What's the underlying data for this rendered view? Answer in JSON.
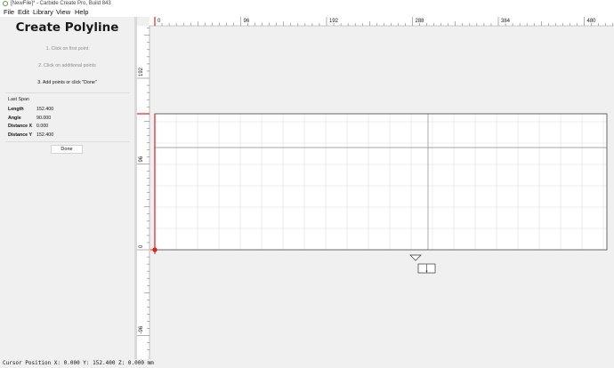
{
  "window": {
    "title": "[NewFile]* - Carbide Create Pro, Build 843"
  },
  "menu": {
    "items": [
      {
        "label": "File"
      },
      {
        "label": "Edit"
      },
      {
        "label": "Library"
      },
      {
        "label": "View"
      },
      {
        "label": "Help"
      }
    ]
  },
  "panel": {
    "title": "Create Polyline",
    "steps": [
      "1. Click on first point",
      "2. Click on additional points",
      "3. Add points or click \"Done\""
    ],
    "last_span": {
      "label": "Last Span",
      "rows": [
        {
          "key": "Length",
          "value": "152.400"
        },
        {
          "key": "Angle",
          "value": "90.000"
        },
        {
          "key": "Distance X",
          "value": "0.000"
        },
        {
          "key": "Distance Y",
          "value": "152.400"
        }
      ]
    },
    "done_label": "Done"
  },
  "rulers": {
    "top": [
      "0",
      "96",
      "192",
      "288",
      "384",
      "480"
    ],
    "left": [
      "192",
      "96",
      "0",
      "-96"
    ]
  },
  "status": {
    "cursor": "Cursor Position X: 0.000 Y: 152.400 Z: 0.000 mm"
  }
}
